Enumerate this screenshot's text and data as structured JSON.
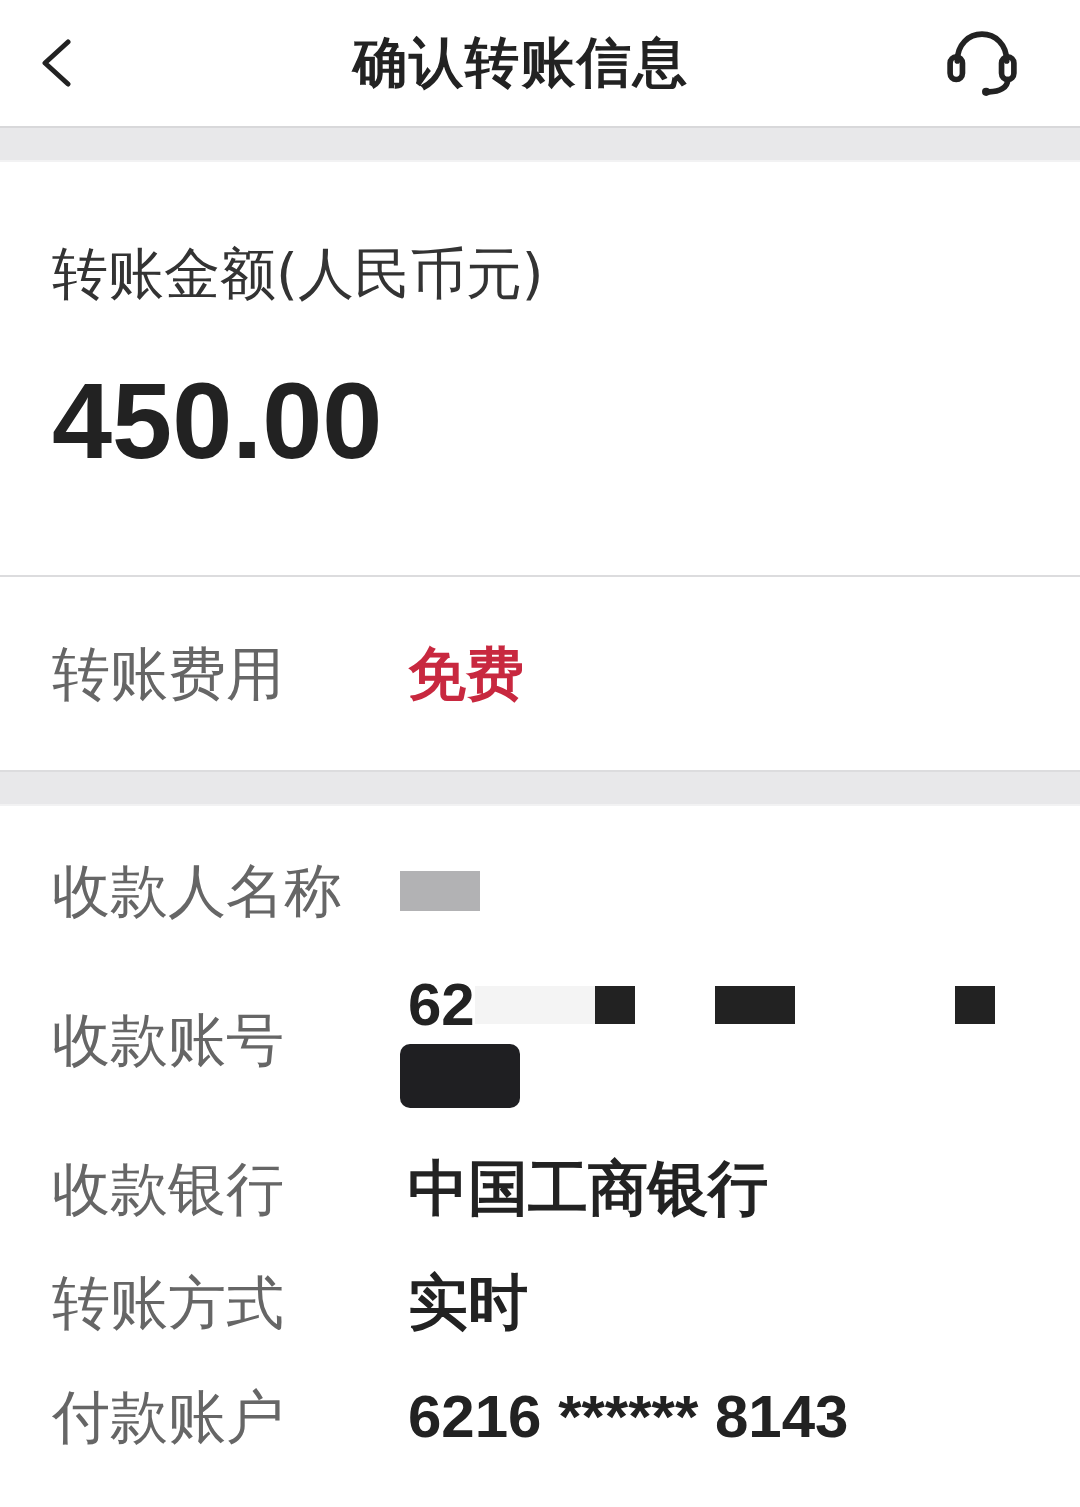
{
  "header": {
    "title": "确认转账信息"
  },
  "amount": {
    "label": "转账金额(人民币元)",
    "value": "450.00"
  },
  "fee": {
    "label": "转账费用",
    "value": "免费"
  },
  "details": [
    {
      "label": "收款人名称",
      "redacted": true
    },
    {
      "label": "收款账号",
      "value": "62",
      "redacted": true
    },
    {
      "label": "收款银行",
      "value": "中国工商银行"
    },
    {
      "label": "转账方式",
      "value": "实时"
    },
    {
      "label": "付款账户",
      "value": "6216 ****** 8143"
    }
  ]
}
